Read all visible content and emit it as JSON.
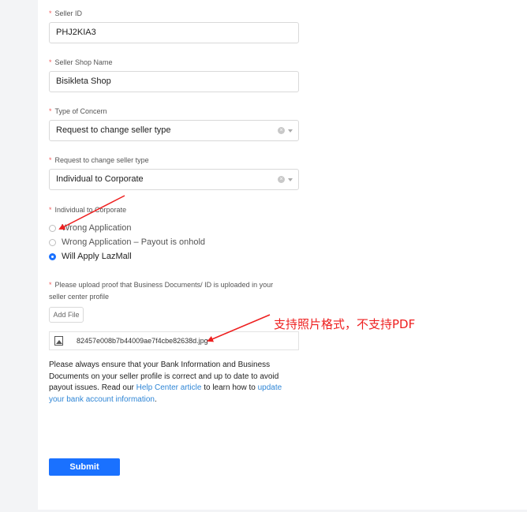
{
  "form": {
    "seller_id": {
      "label": "Seller ID",
      "value": "PHJ2KIA3"
    },
    "shop_name": {
      "label": "Seller Shop Name",
      "value": "Bisikleta Shop"
    },
    "concern": {
      "label": "Type of Concern",
      "value": "Request to change seller type"
    },
    "change_type": {
      "label": "Request to change seller type",
      "value": "Individual to Corporate"
    },
    "sub_reason": {
      "label": "Individual to Corporate",
      "options": [
        "Wrong Application",
        "Wrong Application – Payout is onhold",
        "Will Apply LazMall"
      ],
      "selected": "Will Apply LazMall"
    },
    "upload": {
      "label_line1": "Please upload proof that Business Documents/ ID is uploaded in your",
      "label_line2": "seller center profile",
      "add_file_label": "Add File",
      "file_name": "82457e008b7b44009ae7f4cbe82638d.jpg"
    },
    "notice": {
      "text_before": "Please always ensure that your Bank Information and Business Documents on your seller profile is correct and up to date to avoid payout issues. Read our ",
      "link1": "Help Center article",
      "text_middle": " to learn how to ",
      "link2": "update your bank account information",
      "text_after": "."
    },
    "submit_label": "Submit"
  },
  "annotation": {
    "text": "支持照片格式，不支持PDF",
    "color": "#ee2020"
  },
  "colors": {
    "accent": "#1a71ff",
    "required": "#f25c5c",
    "link": "#2f86d6"
  }
}
